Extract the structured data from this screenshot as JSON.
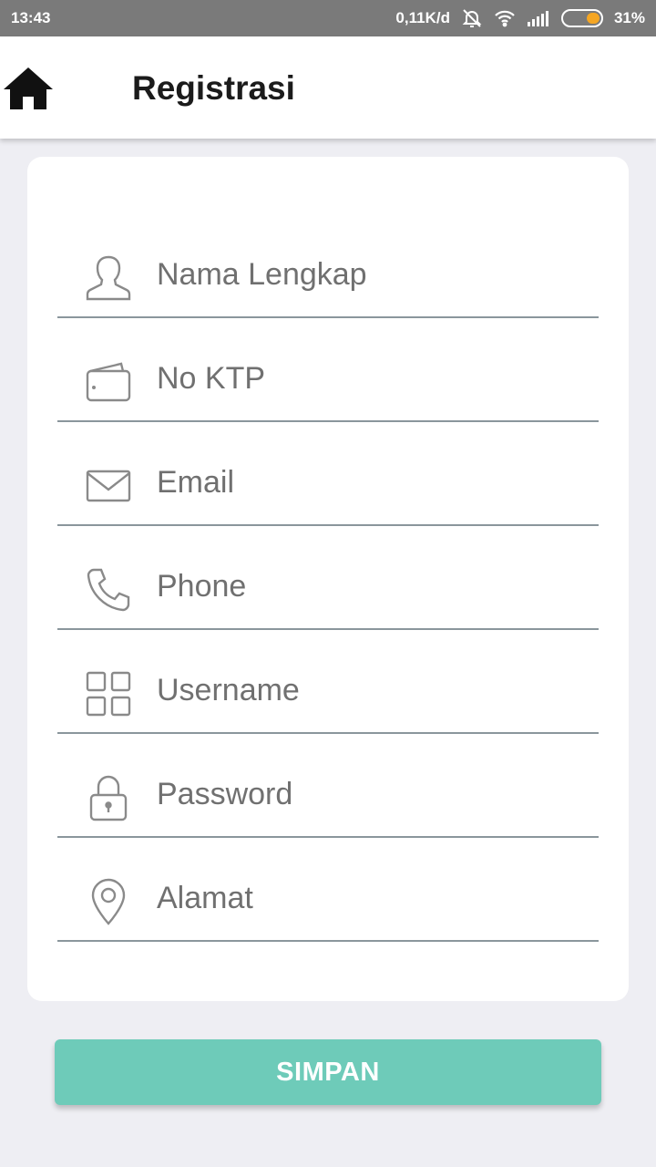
{
  "status_bar": {
    "time": "13:43",
    "network_speed": "0,11K/d",
    "battery_percent": "31%",
    "battery_level": 0.31,
    "icons": [
      "mute-alarm-icon",
      "wifi-icon",
      "signal-icon",
      "battery-icon"
    ]
  },
  "app_bar": {
    "title": "Registrasi",
    "home_icon": "home-icon"
  },
  "form": {
    "fields": [
      {
        "placeholder": "Nama Lengkap",
        "icon": "person-icon"
      },
      {
        "placeholder": "No KTP",
        "icon": "wallet-icon"
      },
      {
        "placeholder": "Email",
        "icon": "envelope-icon"
      },
      {
        "placeholder": "Phone",
        "icon": "phone-icon"
      },
      {
        "placeholder": "Username",
        "icon": "grid-icon"
      },
      {
        "placeholder": "Password",
        "icon": "lock-icon"
      },
      {
        "placeholder": "Alamat",
        "icon": "location-pin-icon"
      }
    ]
  },
  "actions": {
    "save_label": "SIMPAN"
  },
  "colors": {
    "status_bar_bg": "#7a7a7a",
    "page_bg": "#eeeef3",
    "accent_button": "#6ecbb9",
    "battery_fill": "#f5a623",
    "field_underline": "#8a969c",
    "placeholder_text": "#707070"
  }
}
